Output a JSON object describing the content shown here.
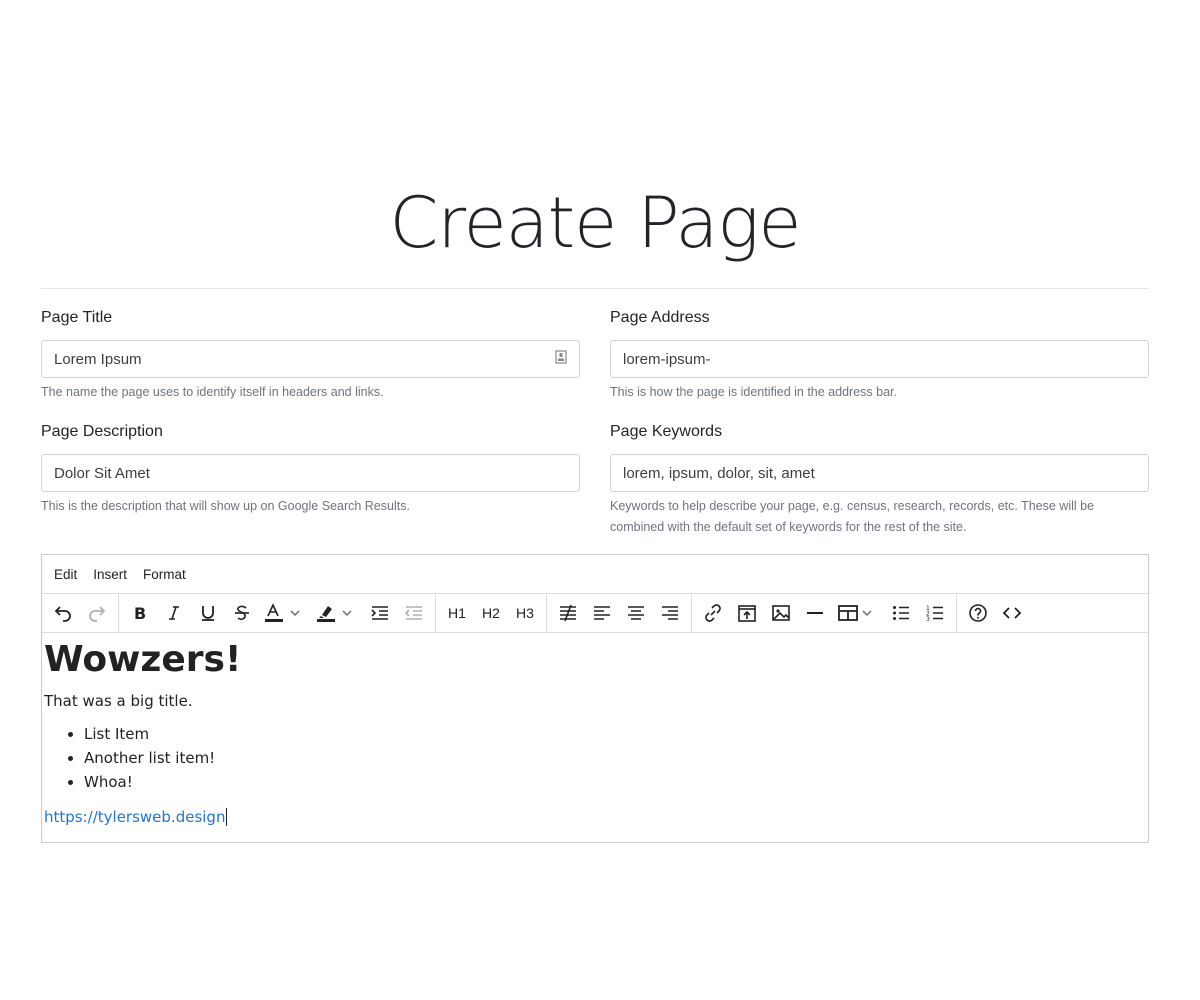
{
  "page": {
    "title": "Create Page"
  },
  "form": {
    "title": {
      "label": "Page Title",
      "value": "Lorem Ipsum",
      "help": "The name the page uses to identify itself in headers and links."
    },
    "address": {
      "label": "Page Address",
      "value": "lorem-ipsum-",
      "help": "This is how the page is identified in the address bar."
    },
    "description": {
      "label": "Page Description",
      "value": "Dolor Sit Amet",
      "help": "This is the description that will show up on Google Search Results."
    },
    "keywords": {
      "label": "Page Keywords",
      "value": "lorem, ipsum, dolor, sit, amet",
      "help": "Keywords to help describe your page, e.g. census, research, records, etc. These will be combined with the default set of keywords for the rest of the site."
    }
  },
  "editor": {
    "menu": [
      "Edit",
      "Insert",
      "Format"
    ],
    "toolbar": {
      "h1": "H1",
      "h2": "H2",
      "h3": "H3"
    },
    "content": {
      "heading": "Wowzers!",
      "paragraph": "That was a big title.",
      "list": [
        "List Item",
        "Another list item!",
        "Whoa!"
      ],
      "link": "https://tylersweb.design"
    }
  },
  "colors": {
    "link": "#2276d2",
    "border": "#ced4da",
    "help_text": "#6c757d"
  }
}
